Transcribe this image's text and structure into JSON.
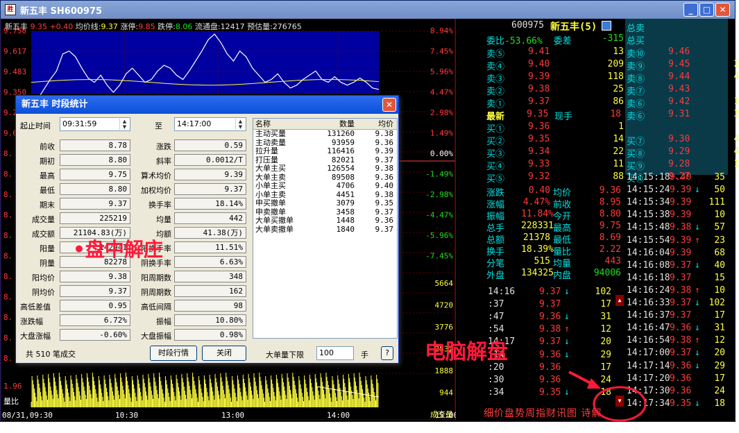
{
  "window": {
    "title": "新五丰  SH600975",
    "min": "_",
    "max": "□",
    "close": "✕"
  },
  "info": {
    "name": "新五丰",
    "price": "9.35",
    "change": "+0.40",
    "avg_label": "均价线:",
    "avg": "9.37",
    "limitup_label": "涨停:",
    "limitup": "9.85",
    "limitdown_label": "跌停:",
    "limitdown": "8.06",
    "float_label": "流通盘:",
    "float": "12417",
    "est_label": "预估量:",
    "est": "276765"
  },
  "chart_data": {
    "type": "line",
    "title": "",
    "y_price_ticks": [
      "9.750",
      "9.617",
      "9.483",
      "9.350",
      "9.2",
      "9.0",
      "8.",
      "8.",
      "8.",
      "8.",
      "8.",
      "8.",
      "8.",
      "8.",
      "8.",
      "8.",
      "8.",
      "1.96",
      "量比"
    ],
    "y_pct_ticks": [
      "8.94%",
      "7.45%",
      "5.96%",
      "4.47%",
      "2.98%",
      "1.49%",
      "0.00%",
      "-1.49%",
      "-2.98%",
      "-4.47%",
      "-5.96%",
      "-7.45%"
    ],
    "y_vol_ticks": [
      "5664",
      "4720",
      "3776",
      "2832",
      "1888",
      "944",
      "成交量"
    ],
    "x_ticks": [
      "08/31,09:30",
      "10:30",
      "13:00",
      "14:00",
      "15:00"
    ],
    "x_realtime_label": "实时",
    "price_series": [
      9.2,
      9.28,
      9.35,
      9.42,
      9.48,
      9.6,
      9.62,
      9.58,
      9.5,
      9.43,
      9.4,
      9.45,
      9.38,
      9.33,
      9.38,
      9.46,
      9.5,
      9.45,
      9.4,
      9.42,
      9.48,
      9.52,
      9.5,
      9.45,
      9.42,
      9.48,
      9.55,
      9.62,
      9.7,
      9.74,
      9.68,
      9.6,
      9.55,
      9.62,
      9.58,
      9.5,
      9.45,
      9.4,
      9.42,
      9.46,
      9.4,
      9.36,
      9.38,
      9.42,
      9.45,
      9.48,
      9.42,
      9.4,
      9.44,
      9.4,
      9.38,
      9.4,
      9.43,
      9.4,
      9.36,
      9.35
    ],
    "ylim": [
      9.32,
      9.76
    ]
  },
  "header": {
    "code": "600975",
    "name": "新五丰(5)",
    "total_sell_label": "总卖",
    "total_buy_label": "总买"
  },
  "weibi": {
    "label1": "委比",
    "val1": "-53.66%",
    "label2": "委差",
    "val2": "-315"
  },
  "sells": [
    {
      "label": "卖⑤",
      "price": "9.41",
      "vol": "13"
    },
    {
      "label": "卖④",
      "price": "9.40",
      "vol": "209"
    },
    {
      "label": "卖③",
      "price": "9.39",
      "vol": "118"
    },
    {
      "label": "卖②",
      "price": "9.38",
      "vol": "25"
    },
    {
      "label": "卖①",
      "price": "9.37",
      "vol": "86"
    }
  ],
  "sells2": [
    {
      "label": "卖⑩",
      "price": "9.46",
      "vol": "10"
    },
    {
      "label": "卖⑨",
      "price": "9.45",
      "vol": "261"
    },
    {
      "label": "卖⑧",
      "price": "9.44",
      "vol": "471"
    },
    {
      "label": "卖⑦",
      "price": "9.43",
      "vol": "99"
    },
    {
      "label": "卖⑥",
      "price": "9.42",
      "vol": "116"
    },
    {
      "label": "卖⑥",
      "price": "9.31",
      "vol": "390"
    }
  ],
  "latest": {
    "label": "最新",
    "price": "9.35",
    "cur_label": "现手",
    "cur": "18"
  },
  "buys": [
    {
      "label": "买①",
      "price": "9.36",
      "vol": "1"
    },
    {
      "label": "买②",
      "price": "9.35",
      "vol": "14"
    },
    {
      "label": "买③",
      "price": "9.34",
      "vol": "22"
    },
    {
      "label": "买④",
      "price": "9.33",
      "vol": "11"
    },
    {
      "label": "买⑤",
      "price": "9.32",
      "vol": "88"
    }
  ],
  "buys2": [
    {
      "label": "买⑦",
      "price": "9.30",
      "vol": "465"
    },
    {
      "label": "买⑧",
      "price": "9.29",
      "vol": "477"
    },
    {
      "label": "买⑨",
      "price": "9.28",
      "vol": "198"
    },
    {
      "label": "买⑩",
      "price": "9.27",
      "vol": "33"
    }
  ],
  "stats": [
    {
      "l1": "涨跌",
      "v1": "0.40",
      "l2": "均价",
      "v2": "9.36"
    },
    {
      "l1": "涨幅",
      "v1": "4.47%",
      "l2": "前收",
      "v2": "8.95"
    },
    {
      "l1": "振幅",
      "v1": "11.84%",
      "l2": "今开",
      "v2": "8.80"
    },
    {
      "l1": "总手",
      "v1": "228331",
      "l2": "最高",
      "v2": "9.75"
    },
    {
      "l1": "总额",
      "v1": "21378",
      "l2": "最低",
      "v2": "8.69"
    },
    {
      "l1": "换手",
      "v1": "18.39%",
      "l2": "量比",
      "v2": "2.22"
    },
    {
      "l1": "分笔",
      "v1": "515",
      "l2": "均量",
      "v2": "443"
    },
    {
      "l1": "外盘",
      "v1": "134325",
      "l2": "内盘",
      "v2": "94006"
    }
  ],
  "ticks_mid": [
    {
      "t": "14:16",
      "p": "9.37",
      "a": "↓",
      "v": "102"
    },
    {
      "t": ":37",
      "p": "9.37",
      "a": "",
      "v": "17"
    },
    {
      "t": ":47",
      "p": "9.36",
      "a": "↓",
      "v": "31"
    },
    {
      "t": ":54",
      "p": "9.38",
      "a": "↑",
      "v": "12"
    },
    {
      "t": "14:17",
      "p": "9.37",
      "a": "↓",
      "v": "20"
    },
    {
      "t": ":14",
      "p": "9.36",
      "a": "↓",
      "v": "29"
    },
    {
      "t": ":20",
      "p": "9.36",
      "a": "",
      "v": "17"
    },
    {
      "t": ":30",
      "p": "9.36",
      "a": "",
      "v": "24"
    },
    {
      "t": ":34",
      "p": "9.35",
      "a": "↓",
      "v": "18"
    }
  ],
  "ticks_right": [
    {
      "t": "14:15:18",
      "p": "9.40",
      "a": "",
      "v": "35"
    },
    {
      "t": "14:15:24",
      "p": "9.39",
      "a": "↓",
      "v": "50"
    },
    {
      "t": "14:15:34",
      "p": "9.39",
      "a": "",
      "v": "111"
    },
    {
      "t": "14:15:38",
      "p": "9.39",
      "a": "",
      "v": "10"
    },
    {
      "t": "14:15:48",
      "p": "9.38",
      "a": "↓",
      "v": "57"
    },
    {
      "t": "14:15:54",
      "p": "9.39",
      "a": "↑",
      "v": "23"
    },
    {
      "t": "14:16:04",
      "p": "9.39",
      "a": "",
      "v": "68"
    },
    {
      "t": "14:16:08",
      "p": "9.37",
      "a": "↓",
      "v": "40"
    },
    {
      "t": "14:16:18",
      "p": "9.37",
      "a": "",
      "v": "15"
    },
    {
      "t": "14:16:24",
      "p": "9.38",
      "a": "↑",
      "v": "10"
    },
    {
      "t": "14:16:33",
      "p": "9.37",
      "a": "↓",
      "v": "102"
    },
    {
      "t": "14:16:37",
      "p": "9.37",
      "a": "",
      "v": "17"
    },
    {
      "t": "14:16:47",
      "p": "9.36",
      "a": "↓",
      "v": "31"
    },
    {
      "t": "14:16:54",
      "p": "9.38",
      "a": "↑",
      "v": "12"
    },
    {
      "t": "14:17:00",
      "p": "9.37",
      "a": "↓",
      "v": "20"
    },
    {
      "t": "14:17:14",
      "p": "9.36",
      "a": "↓",
      "v": "29"
    },
    {
      "t": "14:17:20",
      "p": "9.36",
      "a": "",
      "v": "17"
    },
    {
      "t": "14:17:30",
      "p": "9.36",
      "a": "",
      "v": "24"
    },
    {
      "t": "14:17:34",
      "p": "9.35",
      "a": "↓",
      "v": "18"
    }
  ],
  "tabs": "细价盘势周指财讯图 诗解",
  "dialog": {
    "title": "新五丰  时段统计",
    "start_label": "起止时间",
    "start": "09:31:59",
    "to_label": "至",
    "end": "14:17:00",
    "left": [
      {
        "l": "前收",
        "v": "8.78",
        "l2": "涨跌",
        "v2": "0.59"
      },
      {
        "l": "期初",
        "v": "8.80",
        "l2": "斜率",
        "v2": "0.0012/T"
      },
      {
        "l": "最高",
        "v": "9.75",
        "l2": "算术均价",
        "v2": "9.39"
      },
      {
        "l": "最低",
        "v": "8.80",
        "l2": "加权均价",
        "v2": "9.37"
      },
      {
        "l": "期末",
        "v": "9.37",
        "l2": "换手率",
        "v2": "18.14%"
      },
      {
        "l": "成交量",
        "v": "225219",
        "l2": "均量",
        "v2": "442"
      },
      {
        "l": "成交额",
        "v": "21104.83(万)",
        "l2": "均额",
        "v2": "41.38(万)"
      },
      {
        "l": "阳量",
        "v": "142941",
        "l2": "阳换手率",
        "v2": "11.51%"
      },
      {
        "l": "阴量",
        "v": "82278",
        "l2": "阴换手率",
        "v2": "6.63%"
      },
      {
        "l": "阳均价",
        "v": "9.38",
        "l2": "阳周期数",
        "v2": "348"
      },
      {
        "l": "阴均价",
        "v": "9.37",
        "l2": "阴周期数",
        "v2": "162"
      },
      {
        "l": "高低差值",
        "v": "0.95",
        "l2": "高低间隔",
        "v2": "98"
      },
      {
        "l": "涨跌幅",
        "v": "6.72%",
        "l2": "振幅",
        "v2": "10.80%"
      },
      {
        "l": "大盘涨幅",
        "v": "-0.60%",
        "l2": "大盘振幅",
        "v2": "0.98%"
      }
    ],
    "list_header": {
      "name": "名称",
      "qty": "数量",
      "avg": "均价"
    },
    "list": [
      {
        "n": "主动买量",
        "q": "131260",
        "a": "9.38"
      },
      {
        "n": "主动卖量",
        "q": "93959",
        "a": "9.36"
      },
      {
        "n": "拉升量",
        "q": "116416",
        "a": "9.39"
      },
      {
        "n": "打压量",
        "q": "82021",
        "a": "9.37"
      },
      {
        "n": "大单主买",
        "q": "126554",
        "a": "9.38"
      },
      {
        "n": "大单主卖",
        "q": "89508",
        "a": "9.36"
      },
      {
        "n": "小单主买",
        "q": "4706",
        "a": "9.40"
      },
      {
        "n": "小单主卖",
        "q": "4451",
        "a": "9.38"
      },
      {
        "n": "申买撤单",
        "q": "3079",
        "a": "9.35"
      },
      {
        "n": "申卖撤单",
        "q": "3458",
        "a": "9.37"
      },
      {
        "n": "大单买撤单",
        "q": "1448",
        "a": "9.36"
      },
      {
        "n": "大单卖撤单",
        "q": "1840",
        "a": "9.37"
      }
    ],
    "total_text": "共 510 笔成交",
    "btn_period": "时段行情",
    "btn_close": "关闭",
    "big_label": "大单量下限",
    "big_value": "100",
    "big_unit": "手",
    "help": "?"
  },
  "annotations": {
    "a1": "•盘中解庄",
    "a2": "电脑解盘"
  },
  "colors": {
    "accent": "#ff3b3b",
    "up": "#ff3b3b",
    "down": "#1ce01c",
    "label": "#00e0e0",
    "chart_bg": "#0000a0"
  }
}
